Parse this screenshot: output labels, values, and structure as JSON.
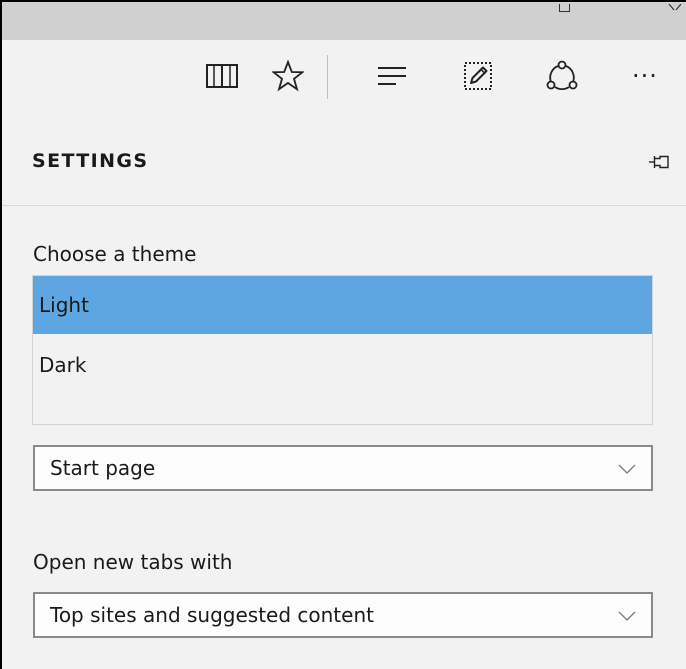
{
  "toolbar": {
    "icons": [
      "reading-view-icon",
      "favorites-star-icon",
      "hub-icon",
      "web-note-icon",
      "share-icon",
      "more-icon"
    ],
    "more_label": "···"
  },
  "settings": {
    "title": "SETTINGS",
    "theme": {
      "label": "Choose a theme",
      "options": [
        {
          "label": "Light",
          "selected": true
        },
        {
          "label": "Dark",
          "selected": false
        }
      ]
    },
    "open_with": {
      "value": "Start page"
    },
    "new_tabs": {
      "label": "Open new tabs with",
      "value": "Top sites and suggested content"
    }
  },
  "colors": {
    "selected_option": "#5ea6e2",
    "pane_background": "#f2f2f2",
    "titlebar": "#d0d0d0"
  }
}
